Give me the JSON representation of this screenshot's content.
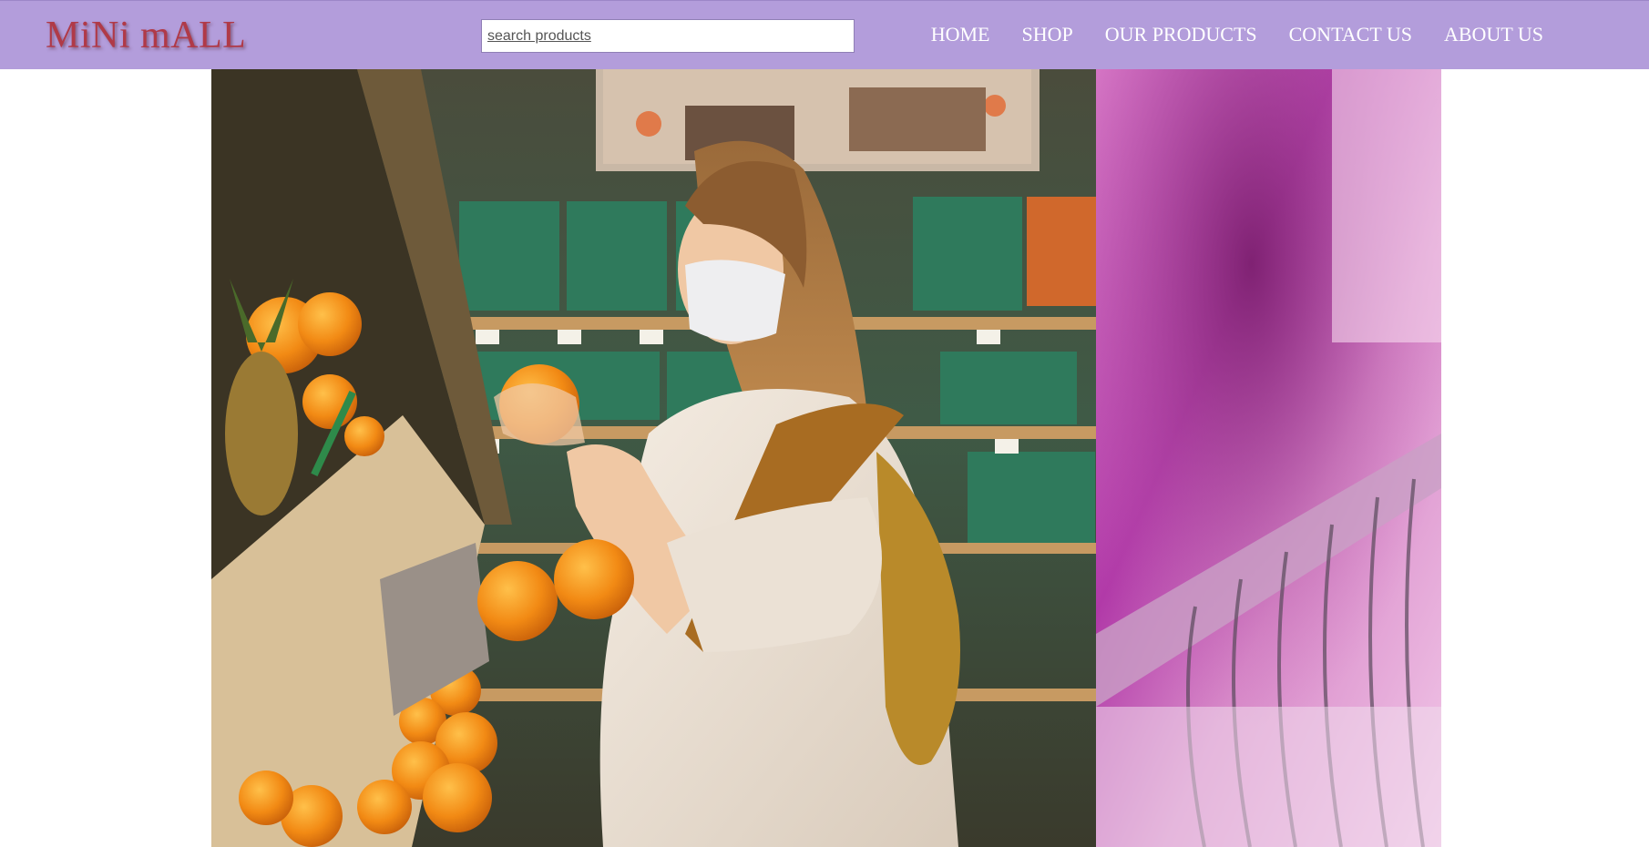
{
  "brand": {
    "logo_text": "MiNi mALL"
  },
  "search": {
    "placeholder": "search products",
    "value": ""
  },
  "nav": {
    "items": [
      {
        "label": "HOME"
      },
      {
        "label": "SHOP"
      },
      {
        "label": "OUR PRODUCTS"
      },
      {
        "label": "CONTACT US"
      },
      {
        "label": "ABOUT US"
      }
    ]
  },
  "hero": {
    "images": [
      {
        "subject": "woman-with-mask-holding-oranges-in-grocery-store"
      },
      {
        "subject": "blurred-pink-clothes-rack-with-hangers"
      }
    ]
  },
  "colors": {
    "navbar_bg": "#b39ddb",
    "logo": "#b03a48",
    "nav_text": "#ffffff",
    "page_bg": "#ffffff"
  }
}
